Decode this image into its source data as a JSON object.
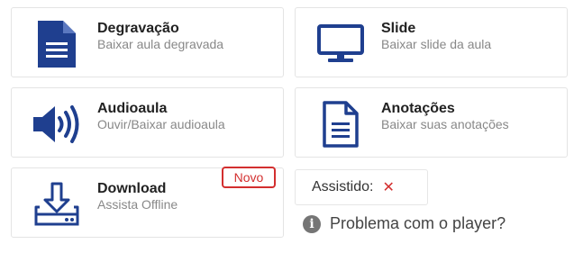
{
  "colors": {
    "icon_blue": "#1f3f8f",
    "badge_red": "#d32f2f"
  },
  "cards": [
    {
      "title": "Degravação",
      "subtitle": "Baixar aula degravada",
      "icon": "document-icon"
    },
    {
      "title": "Slide",
      "subtitle": "Baixar slide da aula",
      "icon": "monitor-icon"
    },
    {
      "title": "Audioaula",
      "subtitle": "Ouvir/Baixar audioaula",
      "icon": "speaker-icon"
    },
    {
      "title": "Anotações",
      "subtitle": "Baixar suas anotações",
      "icon": "notes-icon"
    },
    {
      "title": "Download",
      "subtitle": "Assista Offline",
      "icon": "download-icon",
      "badge": "Novo"
    }
  ],
  "watched": {
    "label": "Assistido:",
    "status_symbol": "✕"
  },
  "problem": {
    "label": "Problema com o player?",
    "icon": "info-icon"
  }
}
